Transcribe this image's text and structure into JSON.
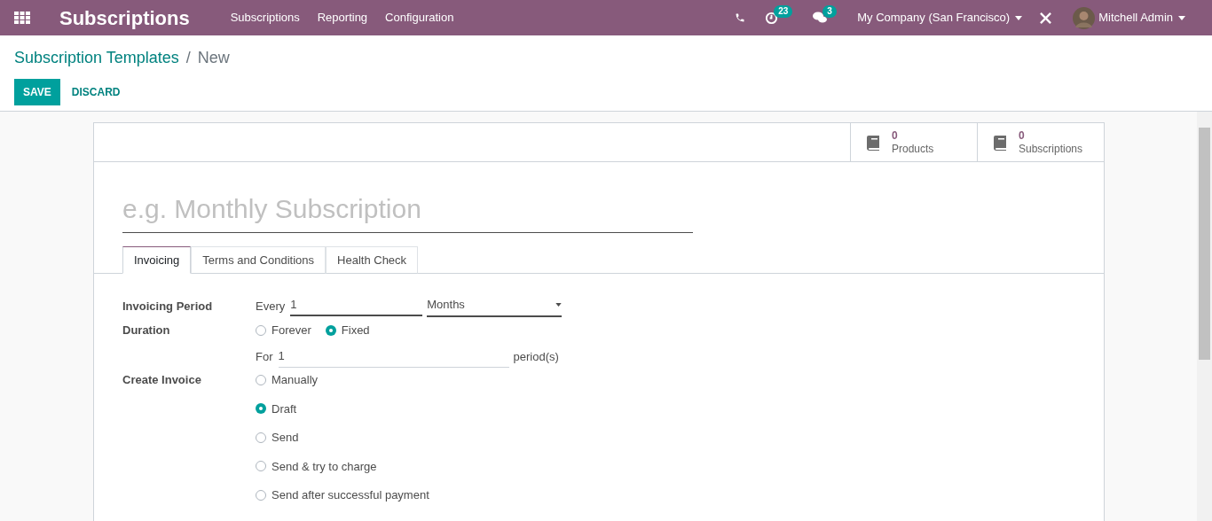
{
  "navbar": {
    "app_title": "Subscriptions",
    "menu": [
      "Subscriptions",
      "Reporting",
      "Configuration"
    ],
    "activity_count": "23",
    "message_count": "3",
    "company": "My Company (San Francisco)",
    "user": "Mitchell Admin"
  },
  "breadcrumb": {
    "parent": "Subscription Templates",
    "separator": "/",
    "current": "New"
  },
  "buttons": {
    "save": "SAVE",
    "discard": "DISCARD"
  },
  "stat_buttons": [
    {
      "value": "0",
      "label": "Products"
    },
    {
      "value": "0",
      "label": "Subscriptions"
    }
  ],
  "name_field": {
    "placeholder": "e.g. Monthly Subscription"
  },
  "tabs": [
    {
      "label": "Invoicing",
      "selected": true
    },
    {
      "label": "Terms and Conditions",
      "selected": false
    },
    {
      "label": "Health Check",
      "selected": false
    }
  ],
  "invoicing_period": {
    "label": "Invoicing Period",
    "prefix": "Every",
    "value": "1",
    "unit": "Months"
  },
  "duration": {
    "label": "Duration",
    "options": [
      {
        "label": "Forever",
        "selected": false
      },
      {
        "label": "Fixed",
        "selected": true
      }
    ],
    "prefix": "For",
    "value": "1",
    "suffix": "period(s)"
  },
  "create_invoice": {
    "label": "Create Invoice",
    "options": [
      {
        "label": "Manually",
        "selected": false
      },
      {
        "label": "Draft",
        "selected": true
      },
      {
        "label": "Send",
        "selected": false
      },
      {
        "label": "Send & try to charge",
        "selected": false
      },
      {
        "label": "Send after successful payment",
        "selected": false
      }
    ]
  }
}
